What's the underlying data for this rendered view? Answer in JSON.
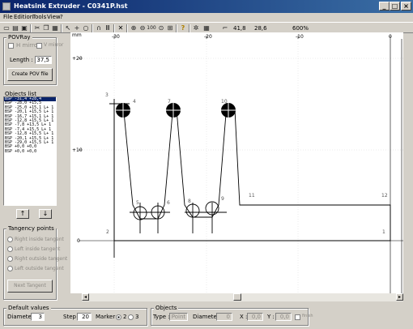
{
  "window": {
    "title": "Heatsink Extruder - C0341P.hst"
  },
  "menu": [
    "File",
    "Edition",
    "Tools",
    "View",
    "?"
  ],
  "toolbar": {
    "coord_x": "41,8",
    "coord_y": "28,6",
    "zoom": "600%",
    "zoom_btn_label": "100"
  },
  "povray": {
    "title": "POVRay",
    "h_mirror": "H mirror",
    "v_mirror": "V mirror",
    "length_label": "Length :",
    "length_value": "37,5",
    "create_btn": "Create POV file"
  },
  "objects_list": {
    "title": "Objects list",
    "items": [
      "BSP -31,4 +28,4",
      "BSP -28,0 +15,5",
      "BSP -25,0 +15,1 L+ 1",
      "BSP -20,1 +15,5 L+ 1",
      "BSP -16,7 +15,1 L+ 1",
      "BSP -12,8 +15,5 L+ 1",
      "BSP -7,8 +13,5 L+ 1",
      "BSP -7,4 +15,5 L+ 1",
      "BSP -12,8 +15,5 L+ 1",
      "BSP -20,1 +15,5 L+ 1",
      "BSP -29,0 +15,5 L+ 1",
      "BSP +0,0 +0,0",
      "BSP +0,0 +0,0"
    ]
  },
  "tangency": {
    "title": "Tangency points",
    "options": [
      "Right inside tangent",
      "Left inside tangent",
      "Right outside tangent",
      "Left outside tangent"
    ],
    "next_btn": "Next Tangent"
  },
  "defaults": {
    "title": "Default values",
    "diameter_label": "Diameter :",
    "diameter_value": "3",
    "step_label": "Step :",
    "step_value": "20",
    "marker_label": "Marker :",
    "marker_opt1": "2",
    "marker_opt2": "3"
  },
  "objects_panel": {
    "title": "Objects",
    "type_label": "Type :",
    "type_value": "Point",
    "diameter_label": "Diameter :",
    "diameter_value": "0",
    "x_label": "X :",
    "x_value": "0,0",
    "y_label": "Y :",
    "y_value": "0,0",
    "finish_label": "finish"
  },
  "canvas": {
    "ruler_unit": "mm",
    "x_ticks": [
      "-30",
      "-20",
      "-10",
      "0"
    ],
    "y_ticks": [
      "+20",
      "+10",
      "0"
    ],
    "point_labels": [
      "1",
      "2",
      "3",
      "4",
      "5",
      "6",
      "7",
      "8",
      "9",
      "10",
      "11",
      "12"
    ]
  }
}
